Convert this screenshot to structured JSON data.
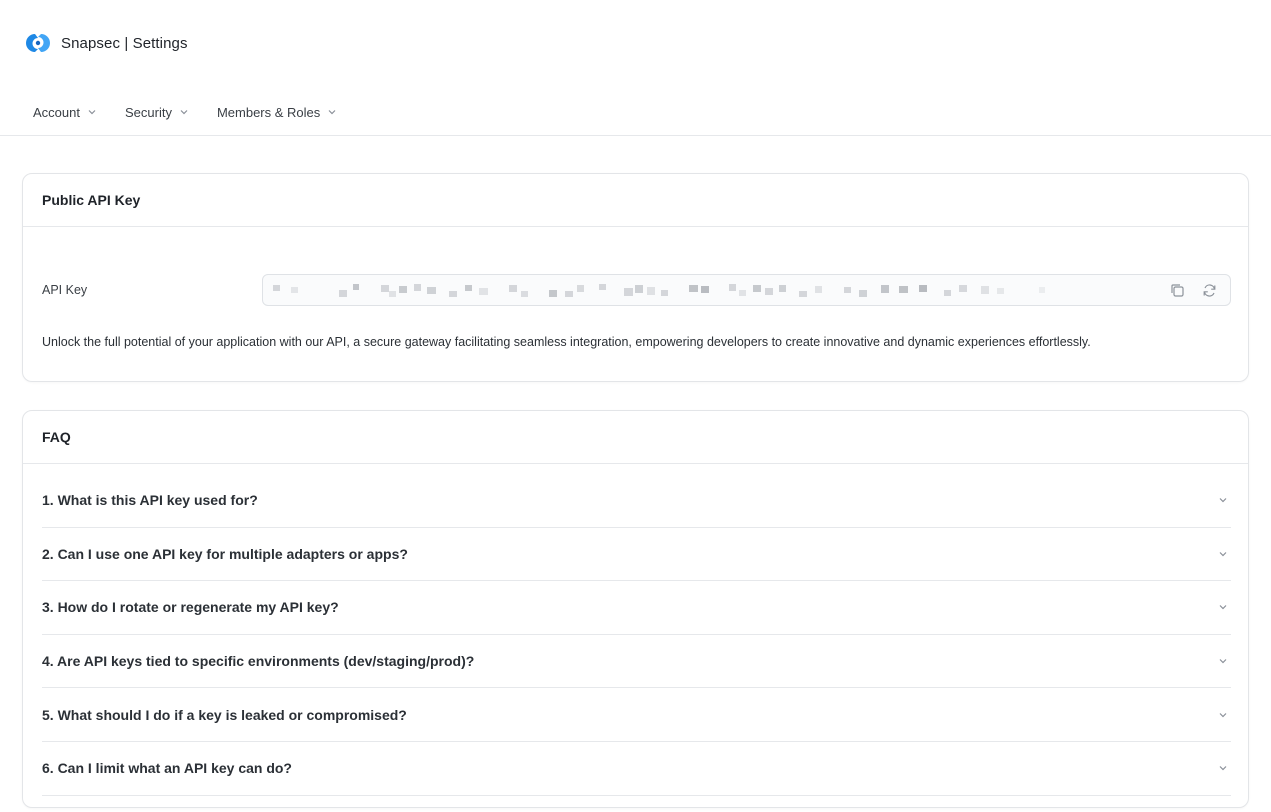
{
  "brand": {
    "title": "Snapsec | Settings",
    "logo_icon": "snapsec-logo-icon",
    "accent": "#1e88e5"
  },
  "nav": {
    "items": [
      {
        "label": "Account",
        "icon": "chevron-down-icon"
      },
      {
        "label": "Security",
        "icon": "chevron-down-icon"
      },
      {
        "label": "Members & Roles",
        "icon": "chevron-down-icon"
      }
    ]
  },
  "api_card": {
    "title": "Public API Key",
    "field_label": "API Key",
    "field_value": "",
    "copy_icon": "copy-icon",
    "refresh_icon": "refresh-icon",
    "description": "Unlock the full potential of your application with our API, a secure gateway facilitating seamless integration, empowering developers to create innovative and dynamic experiences effortlessly."
  },
  "faq": {
    "title": "FAQ",
    "items": [
      {
        "question": "1. What is this API key used for?"
      },
      {
        "question": "2. Can I use one API key for multiple adapters or apps?"
      },
      {
        "question": "3. How do I rotate or regenerate my API key?"
      },
      {
        "question": "4. Are API keys tied to specific environments (dev/staging/prod)?"
      },
      {
        "question": "5. What should I do if a key is leaked or compromised?"
      },
      {
        "question": "6. Can I limit what an API key can do?"
      }
    ]
  }
}
